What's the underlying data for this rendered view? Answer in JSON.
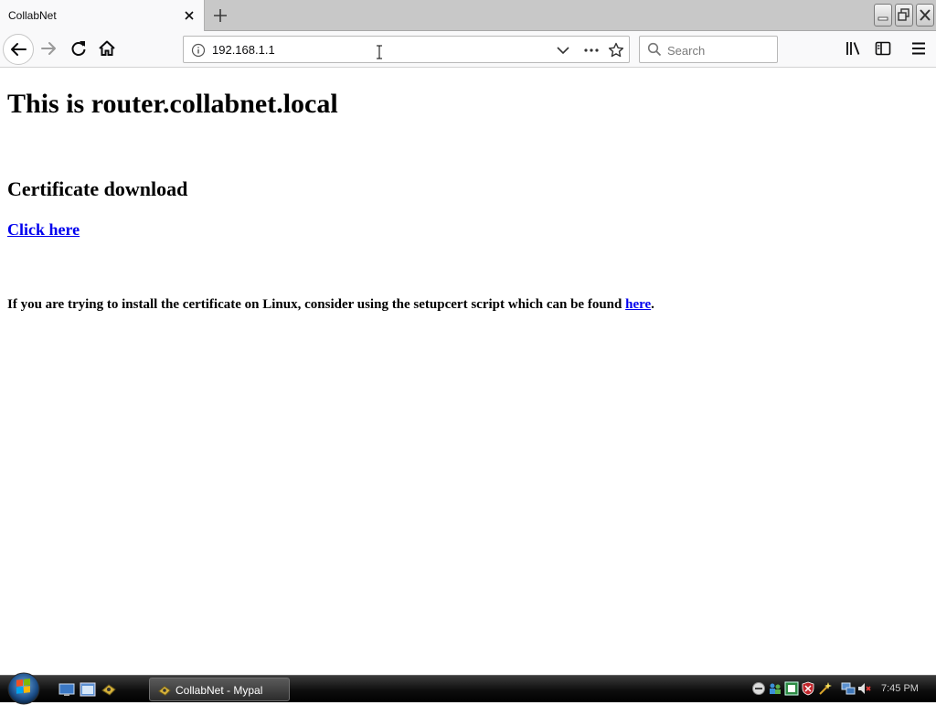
{
  "browser": {
    "tab": {
      "title": "CollabNet"
    },
    "url": "192.168.1.1",
    "search_placeholder": "Search"
  },
  "page": {
    "heading": "This is router.collabnet.local",
    "cert_heading": "Certificate download",
    "cert_link": "Click here",
    "linux_note_prefix": "If you are trying to install the certificate on Linux, consider using the setupcert script which can be found ",
    "linux_note_link": "here",
    "linux_note_suffix": "."
  },
  "taskbar": {
    "active_task": "CollabNet - Mypal",
    "clock": "7:45 PM"
  },
  "colors": {
    "link": "#0000ee",
    "taskbar": "#1a1a1a"
  }
}
